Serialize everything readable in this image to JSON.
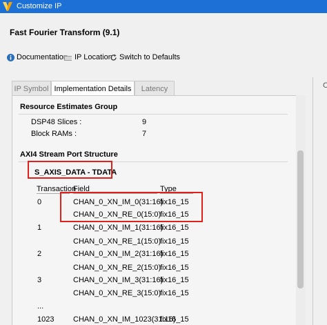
{
  "window": {
    "title": "Customize IP"
  },
  "ip": {
    "name": "Fast Fourier Transform (9.1)"
  },
  "toolbar": {
    "documentation": "Documentation",
    "ip_location": "IP Location",
    "switch_defaults": "Switch to Defaults"
  },
  "tabs": [
    {
      "label": "IP Symbol"
    },
    {
      "label": "Implementation Details"
    },
    {
      "label": "Latency"
    }
  ],
  "resource": {
    "group_title": "Resource Estimates Group",
    "rows": [
      {
        "label": "DSP48 Slices :",
        "value": "9"
      },
      {
        "label": "Block RAMs :",
        "value": "7"
      }
    ]
  },
  "axi": {
    "section_title": "AXI4 Stream Port Structure",
    "port_title": "S_AXIS_DATA - TDATA",
    "headers": {
      "transaction": "Transaction",
      "field": "Field",
      "type": "Type"
    },
    "rows": [
      {
        "transaction": "0",
        "field": "CHAN_0_XN_IM_0(31:16)",
        "type": "fix16_15"
      },
      {
        "transaction": "",
        "field": "CHAN_0_XN_RE_0(15:0)",
        "type": "fix16_15"
      },
      {
        "transaction": "1",
        "field": "CHAN_0_XN_IM_1(31:16)",
        "type": "fix16_15"
      },
      {
        "transaction": "",
        "field": "CHAN_0_XN_RE_1(15:0)",
        "type": "fix16_15"
      },
      {
        "transaction": "2",
        "field": "CHAN_0_XN_IM_2(31:16)",
        "type": "fix16_15"
      },
      {
        "transaction": "",
        "field": "CHAN_0_XN_RE_2(15:0)",
        "type": "fix16_15"
      },
      {
        "transaction": "3",
        "field": "CHAN_0_XN_IM_3(31:16)",
        "type": "fix16_15"
      },
      {
        "transaction": "",
        "field": "CHAN_0_XN_RE_3(15:0)",
        "type": "fix16_15"
      },
      {
        "transaction": "...",
        "field": "",
        "type": ""
      },
      {
        "transaction": "1023",
        "field": "CHAN_0_XN_IM_1023(31:16)",
        "type": "fix16_15"
      }
    ]
  },
  "right_panel": {
    "label": "C"
  },
  "colors": {
    "titlebar": "#1c70d6",
    "highlight": "#e0201b"
  }
}
